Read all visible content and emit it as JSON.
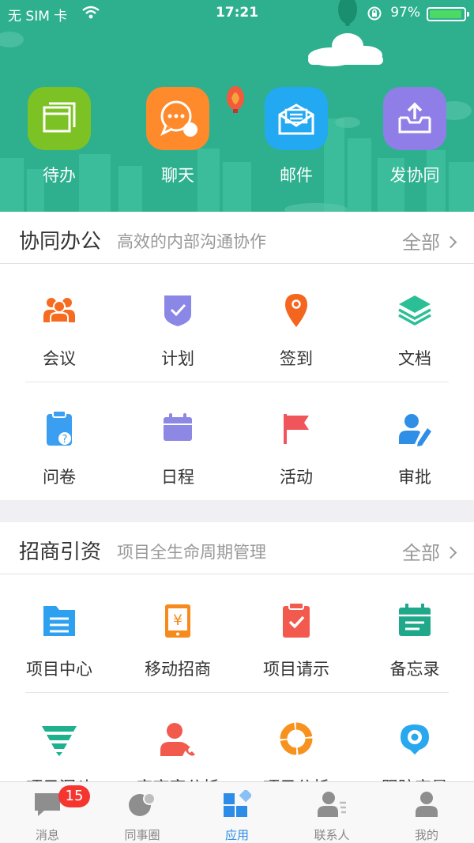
{
  "status_bar": {
    "carrier": "无 SIM 卡",
    "time": "17:21",
    "battery": "97%",
    "battery_level": 0.97
  },
  "quick_actions": [
    {
      "label": "待办",
      "icon": "todo-icon",
      "color": "#7dc224"
    },
    {
      "label": "聊天",
      "icon": "chat-icon",
      "color": "#ff8a2b"
    },
    {
      "label": "邮件",
      "icon": "mail-icon",
      "color": "#23a8f2"
    },
    {
      "label": "发协同",
      "icon": "upload-inbox-icon",
      "color": "#8f7ee8"
    }
  ],
  "sections": [
    {
      "title": "协同办公",
      "subtitle": "高效的内部沟通协作",
      "all_label": "全部",
      "items": [
        {
          "label": "会议",
          "icon": "meeting-icon",
          "color": "#f66b1f"
        },
        {
          "label": "计划",
          "icon": "plan-icon",
          "color": "#8b87e6"
        },
        {
          "label": "签到",
          "icon": "location-pin-icon",
          "color": "#f4661f"
        },
        {
          "label": "文档",
          "icon": "layers-icon",
          "color": "#2bbf96"
        },
        {
          "label": "问卷",
          "icon": "questionnaire-icon",
          "color": "#3a9ff0"
        },
        {
          "label": "日程",
          "icon": "calendar-icon",
          "color": "#8c88e4"
        },
        {
          "label": "活动",
          "icon": "flag-icon",
          "color": "#f0555b"
        },
        {
          "label": "审批",
          "icon": "approval-icon",
          "color": "#2f8fe6"
        }
      ]
    },
    {
      "title": "招商引资",
      "subtitle": "项目全生命周期管理",
      "all_label": "全部",
      "items": [
        {
          "label": "项目中心",
          "icon": "folder-list-icon",
          "color": "#2ea0f0"
        },
        {
          "label": "移动招商",
          "icon": "mobile-yen-icon",
          "color": "#f78a1d"
        },
        {
          "label": "项目请示",
          "icon": "clipboard-check-icon",
          "color": "#f25a4e"
        },
        {
          "label": "备忘录",
          "icon": "memo-calendar-icon",
          "color": "#1fa98a"
        },
        {
          "label": "项目漏斗",
          "icon": "funnel-icon",
          "color": "#1fb08e"
        },
        {
          "label": "实商客分析",
          "icon": "contact-phone-icon",
          "color": "#f25a4e"
        },
        {
          "label": "项目分析",
          "icon": "donut-icon",
          "color": "#f7921e"
        },
        {
          "label": "跟踪定量",
          "icon": "target-pin-icon",
          "color": "#29a7ef"
        }
      ]
    }
  ],
  "tabbar": [
    {
      "label": "消息",
      "icon": "message-icon",
      "badge": "15",
      "active": false
    },
    {
      "label": "同事圈",
      "icon": "moments-icon",
      "active": false
    },
    {
      "label": "应用",
      "icon": "apps-icon",
      "active": true
    },
    {
      "label": "联系人",
      "icon": "contacts-icon",
      "active": false
    },
    {
      "label": "我的",
      "icon": "profile-icon",
      "active": false
    }
  ],
  "colors": {
    "header_bg": "#2eb08f",
    "accent": "#2d8ce8",
    "badge": "#f43530"
  }
}
